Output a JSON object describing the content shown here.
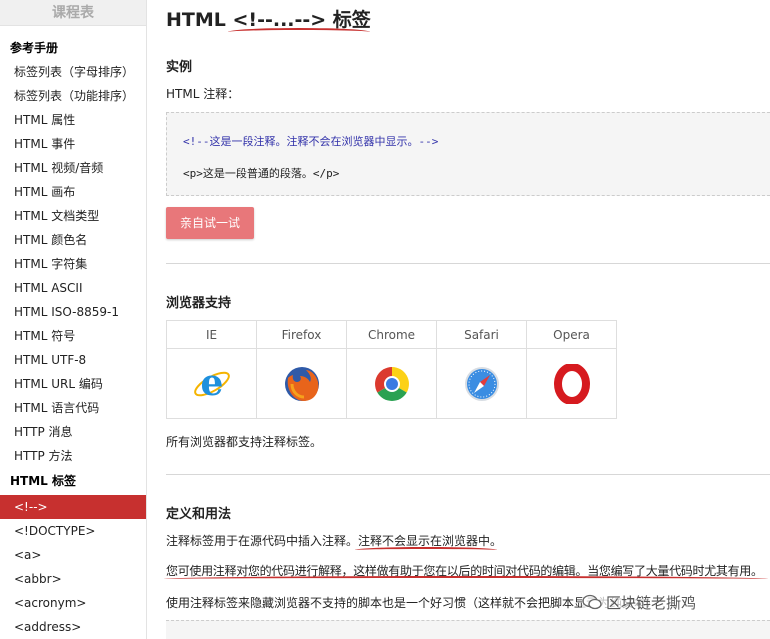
{
  "sidebar": {
    "title": "课程表",
    "section1": "参考手册",
    "items1": [
      "标签列表（字母排序）",
      "标签列表（功能排序）",
      "HTML 属性",
      "HTML 事件",
      "HTML 视频/音频",
      "HTML 画布",
      "HTML 文档类型",
      "HTML 颜色名",
      "HTML 字符集",
      "HTML ASCII",
      "HTML ISO-8859-1",
      "HTML 符号",
      "HTML UTF-8",
      "HTML URL 编码",
      "HTML 语言代码",
      "HTTP 消息",
      "HTTP 方法"
    ],
    "section2": "HTML 标签",
    "items2": [
      "<!-->",
      "<!DOCTYPE>",
      "<a>",
      "<abbr>",
      "<acronym>",
      "<address>"
    ]
  },
  "main": {
    "title": "HTML <!--...--> 标签",
    "example_heading": "实例",
    "example_label": "HTML 注释：",
    "code_comment": "<!--这是一段注释。注释不会在浏览器中显示。-->",
    "code_plain": "<p>这是一段普通的段落。</p>",
    "try_button": "亲自试一试",
    "browser_heading": "浏览器支持",
    "browsers": [
      "IE",
      "Firefox",
      "Chrome",
      "Safari",
      "Opera"
    ],
    "browser_note": "所有浏览器都支持注释标签。",
    "definition_heading": "定义和用法",
    "def_line1": "注释标签用于在源代码中插入注释。注释不会显示在浏览器中。",
    "def_line2": "您可使用注释对您的代码进行解释，这样做有助于您在以后的时间对代码的编辑。当您编写了大量代码时尤其有用。",
    "def_line3": "使用注释标签来隐藏浏览器不支持的脚本也是一个好习惯（这样就不会把脚本显示为纯文本）"
  },
  "watermark": "区块链老撕鸡",
  "colors": {
    "accent": "#c7302f",
    "try_button": "#e8777a",
    "code_comment": "#3333aa"
  }
}
